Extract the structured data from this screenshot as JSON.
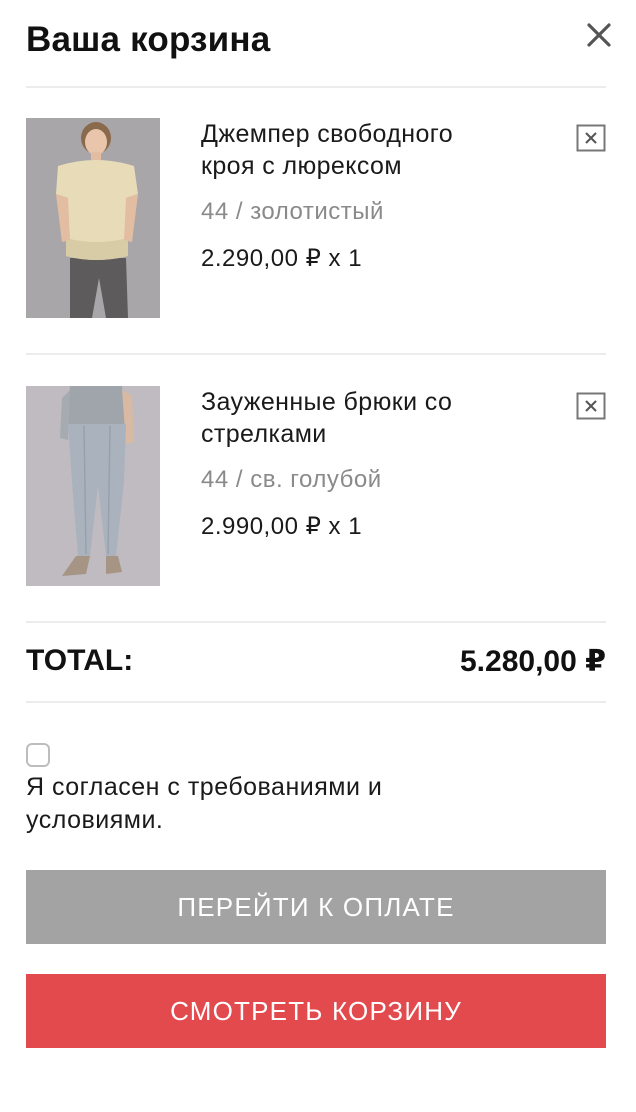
{
  "header": {
    "title": "Ваша корзина",
    "close_icon": "close-icon"
  },
  "cart": {
    "items": [
      {
        "name_line1": "Джемпер свободного",
        "name_line2": "кроя с люрексом",
        "variant": "44 / золотистый",
        "price": "2.290,00 ₽ x 1",
        "image": "jumper-photo"
      },
      {
        "name_line1": "Зауженные брюки со",
        "name_line2": "стрелками",
        "variant": "44 / св. голубой",
        "price": "2.990,00 ₽ x 1",
        "image": "trousers-photo"
      }
    ],
    "remove_icon": "remove-item-icon"
  },
  "total": {
    "label": "TOTAL:",
    "value": "5.280,00 ₽"
  },
  "terms": {
    "checked": false,
    "text_line1": "Я согласен с требованиями и",
    "text_line2": "условиями."
  },
  "buttons": {
    "checkout_label": "ПЕРЕЙТИ К ОПЛАТЕ",
    "view_cart_label": "СМОТРЕТЬ КОРЗИНУ"
  },
  "colors": {
    "checkout_button": "#a3a3a3",
    "view_cart_button": "#e34a4e",
    "divider": "#ececec",
    "variant_text": "#8a8a8a"
  }
}
